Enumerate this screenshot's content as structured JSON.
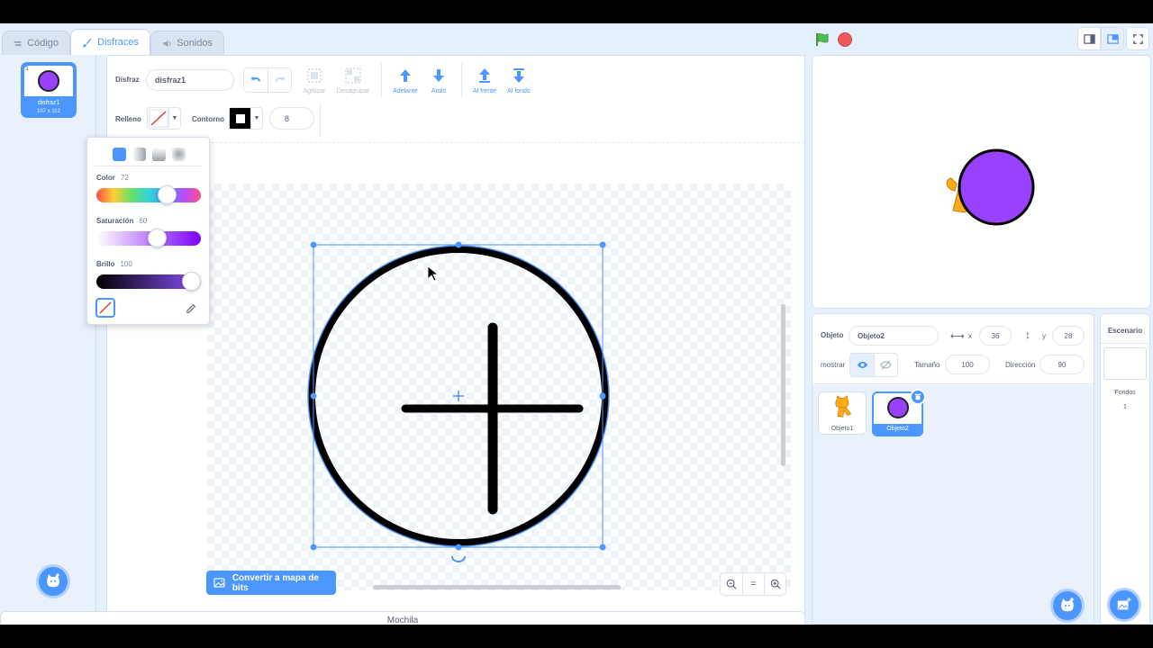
{
  "tabs": [
    {
      "label": "Código",
      "icon": "code-icon"
    },
    {
      "label": "Disfraces",
      "icon": "brush-icon"
    },
    {
      "label": "Sonidos",
      "icon": "speaker-icon"
    }
  ],
  "costume_list": {
    "items": [
      {
        "number": "1",
        "name": "disfraz1",
        "size": "107 x 112"
      }
    ]
  },
  "editor": {
    "costume_label": "Disfraz",
    "costume_name": "disfraz1",
    "tools": {
      "group": "Agrupar",
      "ungroup": "Desagrupar",
      "forward": "Adelante",
      "backward": "Atrás",
      "front": "Al frente",
      "back": "Al fondo"
    },
    "fill_label": "Relleno",
    "outline_label": "Contorno",
    "outline_size": "8",
    "convert_button": "Convertir a mapa de bits",
    "zoom_reset": "="
  },
  "color_popup": {
    "color_label": "Color",
    "color_value": "72",
    "color_level": 0.72,
    "saturation_label": "Saturación",
    "saturation_value": "60",
    "saturation_level": 0.6,
    "brightness_label": "Brillo",
    "brightness_value": "100",
    "brightness_level": 1.0
  },
  "sprite_info": {
    "sprite_label": "Objeto",
    "sprite_name": "Objeto2",
    "x_label": "x",
    "x_value": "36",
    "y_label": "y",
    "y_value": "28",
    "show_label": "mostrar",
    "size_label": "Tamaño",
    "size_value": "100",
    "direction_label": "Dirección",
    "direction_value": "90"
  },
  "sprites": [
    {
      "name": "Objeto1"
    },
    {
      "name": "Objeto2"
    }
  ],
  "scenario": {
    "title": "Escenario",
    "backdrops_label": "Fondos",
    "backdrops_count": "1"
  },
  "backpack": {
    "label": "Mochila"
  },
  "colors": {
    "accent": "#4c97ff",
    "costume_fill": "#9a40ff",
    "green_flag": "#4cbf56",
    "stop": "#ec5959"
  }
}
